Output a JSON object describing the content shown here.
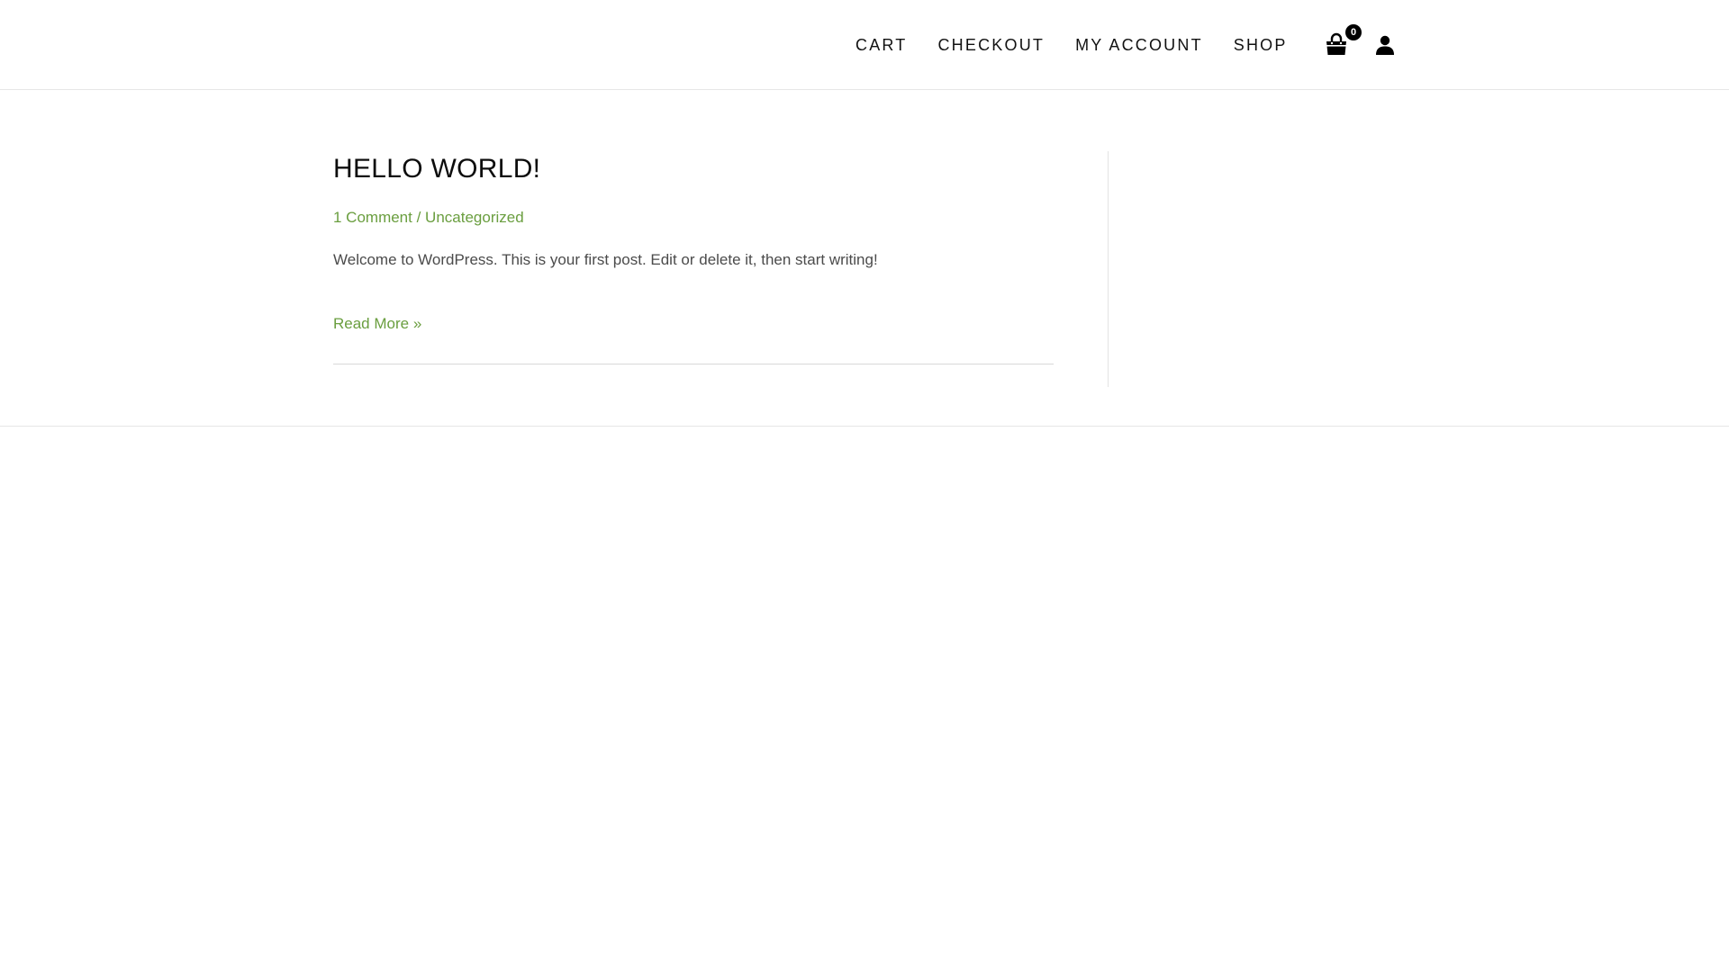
{
  "nav": {
    "items": [
      {
        "label": "CART"
      },
      {
        "label": "CHECKOUT"
      },
      {
        "label": "MY ACCOUNT"
      },
      {
        "label": "SHOP"
      }
    ],
    "cart_count": "0",
    "cart_icon": "shopping-bag-icon",
    "account_icon": "user-icon"
  },
  "post": {
    "title": "HELLO WORLD!",
    "meta": {
      "comments": "1 Comment",
      "separator": " / ",
      "category": "Uncategorized"
    },
    "excerpt": "Welcome to WordPress. This is your first post. Edit or delete it, then start writing!",
    "read_more": "Read More »"
  },
  "colors": {
    "accent": "#6a9e3f",
    "text": "#4b4b4b",
    "heading": "#0d0d0d"
  }
}
